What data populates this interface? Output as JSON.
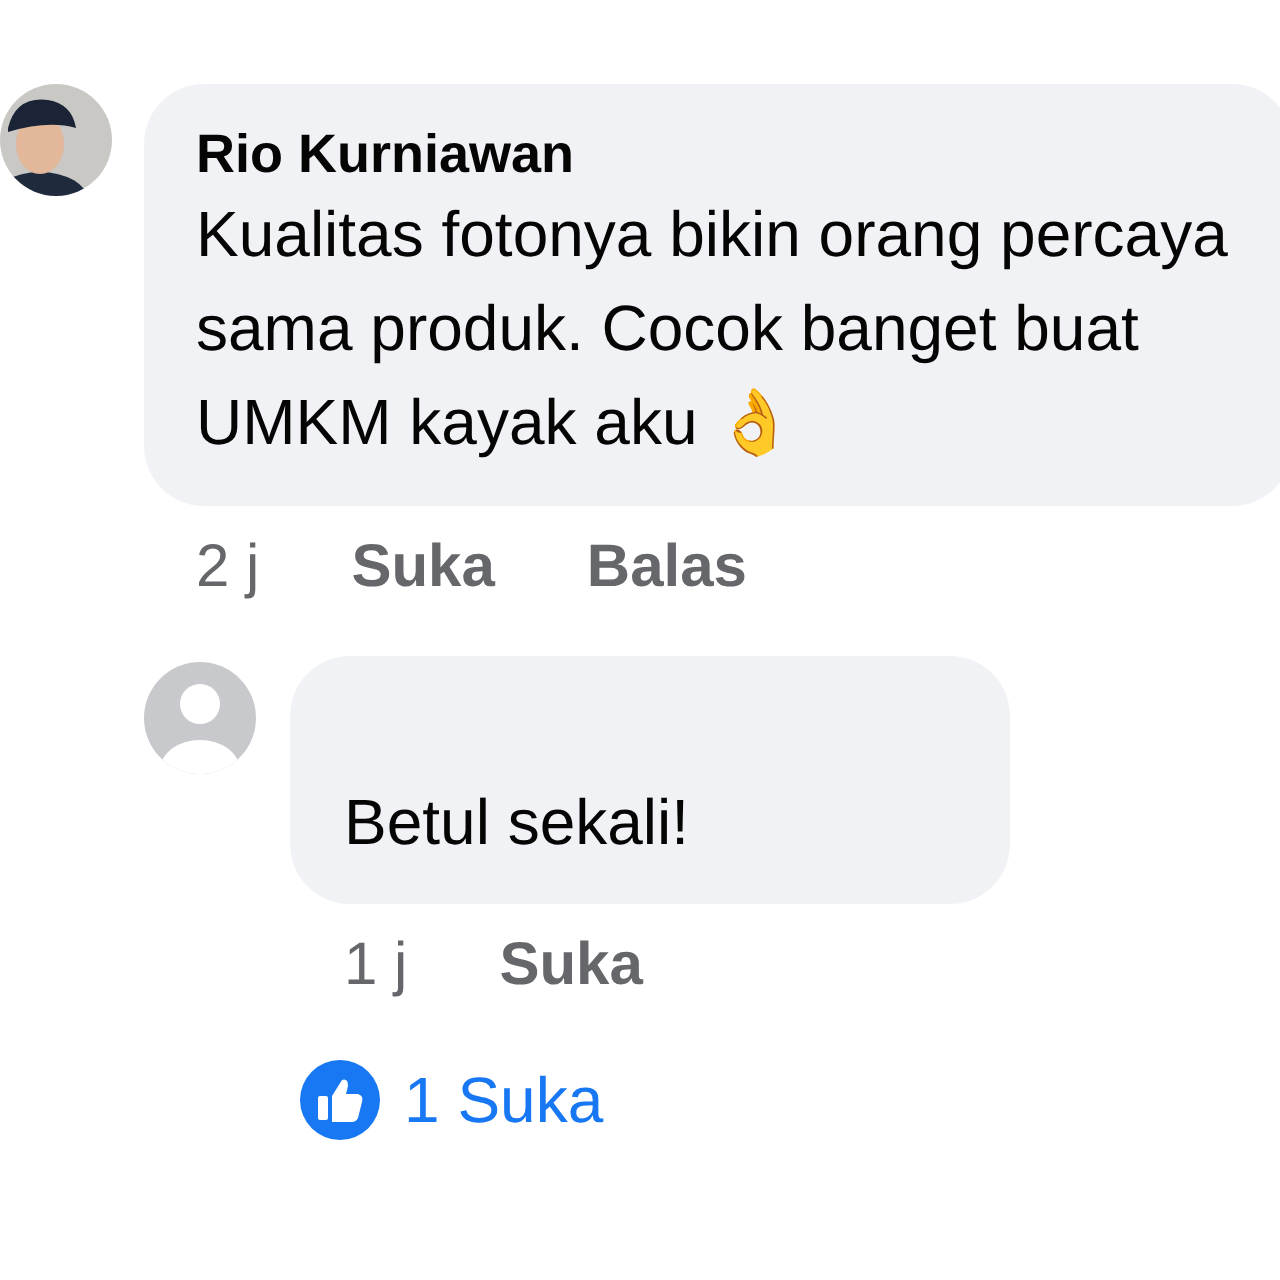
{
  "comment": {
    "avatar": {
      "kind": "photo"
    },
    "author": "Rio Kurniawan",
    "text": "Kualitas fotonya bikin orang percaya sama produk. Cocok banget buat UMKM kayak aku 👌",
    "time": "2 j",
    "actions": [
      "Suka",
      "Balas"
    ]
  },
  "reply": {
    "avatar": {
      "kind": "default"
    },
    "text": "Betul sekali!",
    "time": "1 j",
    "actions": [
      "Suka"
    ],
    "likes": "1 Suka"
  }
}
